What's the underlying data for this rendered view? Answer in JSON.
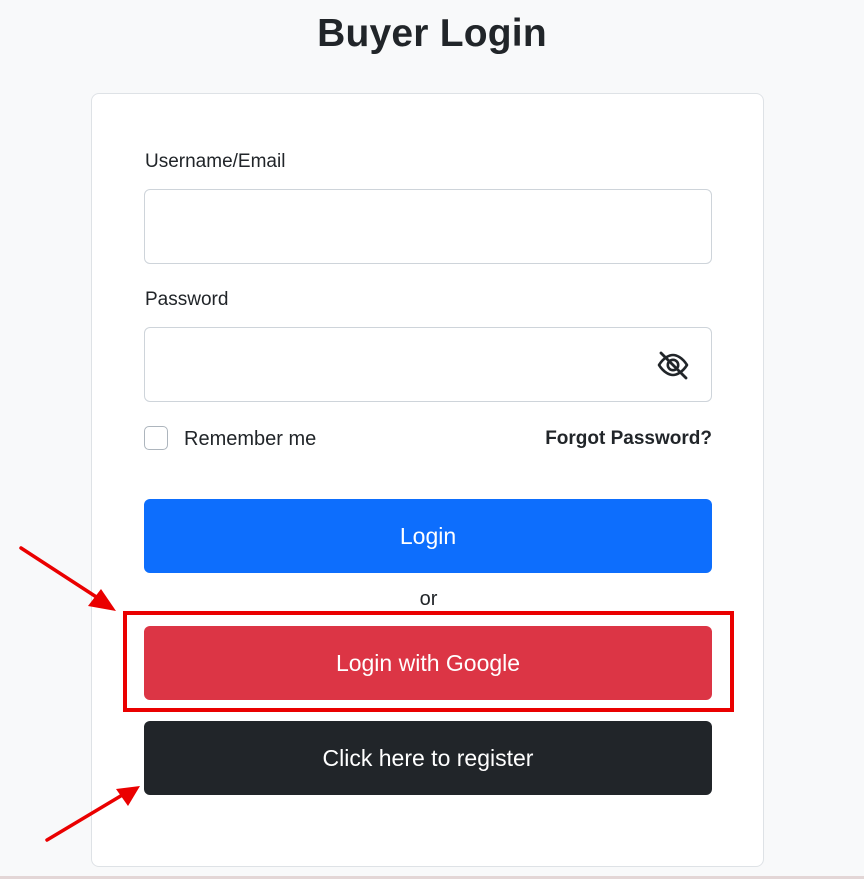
{
  "page": {
    "title": "Buyer Login"
  },
  "form": {
    "username_label": "Username/Email",
    "username_value": "",
    "password_label": "Password",
    "password_value": "",
    "remember_label": "Remember me",
    "remember_checked": false,
    "forgot_label": "Forgot Password?",
    "login_button": "Login",
    "or_text": "or",
    "google_button": "Login with Google",
    "register_button": "Click here to register"
  },
  "icons": {
    "password_toggle": "eye-slash-icon"
  },
  "colors": {
    "login_button": "#0d6efd",
    "google_button": "#dc3545",
    "register_button": "#212529",
    "annotation": "#ea0000"
  }
}
